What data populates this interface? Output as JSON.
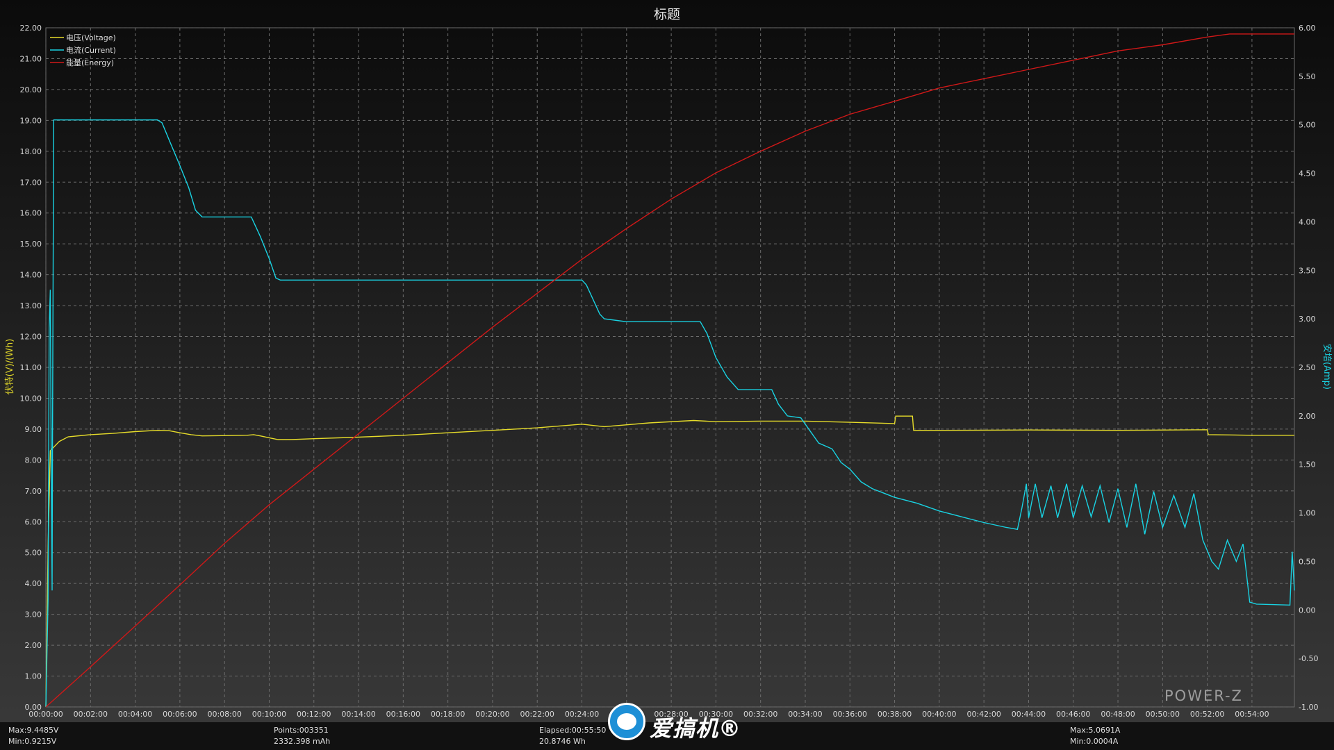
{
  "chart_data": {
    "type": "line",
    "title": "标题",
    "ylabel_left": "伏特(V)/(Wh)",
    "ylabel_right": "安培(Amp)",
    "ylim_left": [
      0,
      22
    ],
    "ylim_right": [
      -1,
      6
    ],
    "grid": true,
    "legend_position": "top-left",
    "y_ticks_left": [
      "0.00",
      "1.00",
      "2.00",
      "3.00",
      "4.00",
      "5.00",
      "6.00",
      "7.00",
      "8.00",
      "9.00",
      "10.00",
      "11.00",
      "12.00",
      "13.00",
      "14.00",
      "15.00",
      "16.00",
      "17.00",
      "18.00",
      "19.00",
      "20.00",
      "21.00",
      "22.00"
    ],
    "y_ticks_right": [
      "-1.00",
      "-0.50",
      "0.00",
      "0.50",
      "1.00",
      "1.50",
      "2.00",
      "2.50",
      "3.00",
      "3.50",
      "4.00",
      "4.50",
      "5.00",
      "5.50",
      "6.00"
    ],
    "x_ticks": [
      "00:00:00",
      "00:02:00",
      "00:04:00",
      "00:06:00",
      "00:08:00",
      "00:10:00",
      "00:12:00",
      "00:14:00",
      "00:16:00",
      "00:18:00",
      "00:20:00",
      "00:22:00",
      "00:24:00",
      "00:26:00",
      "00:28:00",
      "00:30:00",
      "00:32:00",
      "00:34:00",
      "00:36:00",
      "00:38:00",
      "00:40:00",
      "00:42:00",
      "00:44:00",
      "00:46:00",
      "00:48:00",
      "00:50:00",
      "00:52:00",
      "00:54:00"
    ],
    "x_unit": "minutes",
    "x_max": 55.9,
    "series": [
      {
        "name": "电压(Voltage)",
        "axis": "left",
        "color": "#e6dc2a",
        "points": [
          [
            0,
            0
          ],
          [
            0.1,
            5.2
          ],
          [
            0.2,
            8.3
          ],
          [
            0.6,
            8.6
          ],
          [
            1,
            8.75
          ],
          [
            2,
            8.82
          ],
          [
            3,
            8.86
          ],
          [
            4,
            8.92
          ],
          [
            5,
            8.96
          ],
          [
            5.5,
            8.95
          ],
          [
            6,
            8.88
          ],
          [
            6.5,
            8.82
          ],
          [
            7,
            8.78
          ],
          [
            9,
            8.8
          ],
          [
            9.3,
            8.82
          ],
          [
            9.6,
            8.78
          ],
          [
            10,
            8.72
          ],
          [
            10.4,
            8.66
          ],
          [
            11,
            8.66
          ],
          [
            12,
            8.69
          ],
          [
            14,
            8.74
          ],
          [
            16,
            8.8
          ],
          [
            18,
            8.88
          ],
          [
            20,
            8.96
          ],
          [
            22,
            9.04
          ],
          [
            24,
            9.16
          ],
          [
            25,
            9.08
          ],
          [
            27,
            9.2
          ],
          [
            29,
            9.28
          ],
          [
            30,
            9.24
          ],
          [
            32,
            9.26
          ],
          [
            34,
            9.26
          ],
          [
            36,
            9.22
          ],
          [
            38,
            9.18
          ],
          [
            38.05,
            9.42
          ],
          [
            38.8,
            9.42
          ],
          [
            38.85,
            8.96
          ],
          [
            40,
            8.96
          ],
          [
            44,
            8.97
          ],
          [
            48,
            8.96
          ],
          [
            52,
            8.98
          ],
          [
            52.05,
            8.82
          ],
          [
            54,
            8.8
          ],
          [
            55.9,
            8.8
          ]
        ]
      },
      {
        "name": "电流(Current)",
        "axis": "right",
        "color": "#19d2e2",
        "points": [
          [
            0,
            -1
          ],
          [
            0.1,
            0.1
          ],
          [
            0.15,
            2.9
          ],
          [
            0.2,
            3.3
          ],
          [
            0.25,
            1.2
          ],
          [
            0.28,
            0.2
          ],
          [
            0.3,
            1.8
          ],
          [
            0.35,
            5.05
          ],
          [
            1,
            5.05
          ],
          [
            2,
            5.05
          ],
          [
            3,
            5.05
          ],
          [
            4,
            5.05
          ],
          [
            5,
            5.05
          ],
          [
            5.2,
            5.02
          ],
          [
            5.6,
            4.8
          ],
          [
            6,
            4.58
          ],
          [
            6.4,
            4.35
          ],
          [
            6.7,
            4.12
          ],
          [
            7,
            4.05
          ],
          [
            8,
            4.05
          ],
          [
            9.2,
            4.05
          ],
          [
            9.6,
            3.85
          ],
          [
            10,
            3.62
          ],
          [
            10.3,
            3.42
          ],
          [
            10.5,
            3.4
          ],
          [
            12,
            3.4
          ],
          [
            15,
            3.4
          ],
          [
            18,
            3.4
          ],
          [
            21,
            3.4
          ],
          [
            24,
            3.4
          ],
          [
            24.2,
            3.35
          ],
          [
            24.5,
            3.2
          ],
          [
            24.8,
            3.05
          ],
          [
            25,
            3.0
          ],
          [
            26,
            2.97
          ],
          [
            28,
            2.97
          ],
          [
            29.3,
            2.97
          ],
          [
            29.6,
            2.85
          ],
          [
            30,
            2.6
          ],
          [
            30.5,
            2.4
          ],
          [
            31,
            2.27
          ],
          [
            32,
            2.27
          ],
          [
            32.5,
            2.27
          ],
          [
            32.8,
            2.12
          ],
          [
            33.2,
            2.0
          ],
          [
            33.8,
            1.98
          ],
          [
            34.2,
            1.85
          ],
          [
            34.6,
            1.72
          ],
          [
            35.2,
            1.66
          ],
          [
            35.6,
            1.52
          ],
          [
            36,
            1.45
          ],
          [
            36.5,
            1.32
          ],
          [
            37,
            1.25
          ],
          [
            38,
            1.16
          ],
          [
            39,
            1.1
          ],
          [
            40,
            1.02
          ],
          [
            41,
            0.96
          ],
          [
            42,
            0.9
          ],
          [
            43,
            0.85
          ],
          [
            43.5,
            0.83
          ],
          [
            43.7,
            1.05
          ],
          [
            43.9,
            1.3
          ],
          [
            44,
            0.95
          ],
          [
            44.3,
            1.3
          ],
          [
            44.6,
            0.95
          ],
          [
            45,
            1.28
          ],
          [
            45.3,
            0.95
          ],
          [
            45.7,
            1.3
          ],
          [
            46,
            0.95
          ],
          [
            46.4,
            1.28
          ],
          [
            46.8,
            0.96
          ],
          [
            47.2,
            1.28
          ],
          [
            47.6,
            0.9
          ],
          [
            48,
            1.25
          ],
          [
            48.4,
            0.85
          ],
          [
            48.8,
            1.3
          ],
          [
            49.2,
            0.78
          ],
          [
            49.6,
            1.22
          ],
          [
            50,
            0.85
          ],
          [
            50.5,
            1.18
          ],
          [
            51,
            0.85
          ],
          [
            51.4,
            1.2
          ],
          [
            51.8,
            0.72
          ],
          [
            52.2,
            0.5
          ],
          [
            52.5,
            0.42
          ],
          [
            52.9,
            0.72
          ],
          [
            53.3,
            0.5
          ],
          [
            53.6,
            0.68
          ],
          [
            53.9,
            0.08
          ],
          [
            54.2,
            0.06
          ],
          [
            55.7,
            0.05
          ],
          [
            55.8,
            0.6
          ],
          [
            55.9,
            0.2
          ]
        ]
      },
      {
        "name": "能量(Energy)",
        "axis": "left",
        "color": "#d01818",
        "points": [
          [
            0,
            0
          ],
          [
            2,
            1.3
          ],
          [
            4,
            2.62
          ],
          [
            6,
            3.95
          ],
          [
            8,
            5.3
          ],
          [
            10,
            6.55
          ],
          [
            12,
            7.7
          ],
          [
            14,
            8.85
          ],
          [
            16,
            10.0
          ],
          [
            18,
            11.15
          ],
          [
            20,
            12.3
          ],
          [
            22,
            13.4
          ],
          [
            24,
            14.5
          ],
          [
            26,
            15.5
          ],
          [
            28,
            16.45
          ],
          [
            30,
            17.3
          ],
          [
            32,
            18.0
          ],
          [
            34,
            18.65
          ],
          [
            36,
            19.2
          ],
          [
            38,
            19.62
          ],
          [
            40,
            20.05
          ],
          [
            42,
            20.35
          ],
          [
            44,
            20.65
          ],
          [
            46,
            20.95
          ],
          [
            48,
            21.25
          ],
          [
            50,
            21.45
          ],
          [
            52,
            21.7
          ],
          [
            53,
            21.8
          ],
          [
            55.9,
            21.8
          ]
        ]
      }
    ],
    "stats": {
      "voltage_max": "Max:9.4485V",
      "voltage_min": "Min:0.9215V",
      "points": "Points:003351",
      "mah": "2332.398 mAh",
      "elapsed": "Elapsed:00:55:50",
      "wh": "20.8746 Wh",
      "current_max": "Max:5.0691A",
      "current_min": "Min:0.0004A"
    }
  },
  "branding": {
    "logo_text": "爱搞机®",
    "watermark": "POWER-Z"
  }
}
